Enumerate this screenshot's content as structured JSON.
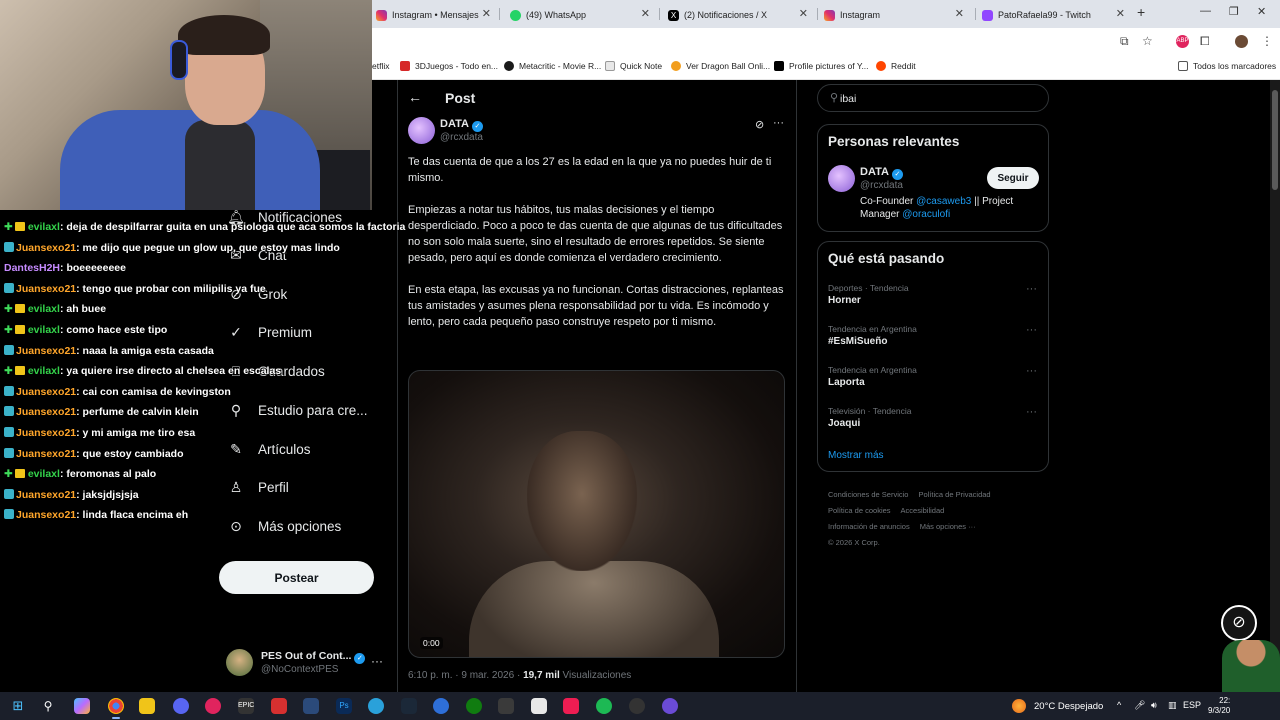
{
  "browser": {
    "tabs": [
      {
        "label": "Instagram • Mensajes",
        "icon": "instagram-icon",
        "color": "#e1306c"
      },
      {
        "label": "(49) WhatsApp",
        "icon": "whatsapp-icon",
        "color": "#25d366"
      },
      {
        "label": "(2) Notificaciones / X",
        "icon": "x-logo-icon",
        "color": "#000000"
      },
      {
        "label": "Instagram",
        "icon": "instagram-icon",
        "color": "#e1306c"
      },
      {
        "label": "PatoRafaela99 - Twitch",
        "icon": "twitch-icon",
        "color": "#9146ff"
      }
    ],
    "bookmarks": [
      {
        "label": "etflix",
        "color": "#e50914"
      },
      {
        "label": "3DJuegos - Todo en...",
        "color": "#d62828"
      },
      {
        "label": "Metacritic - Movie R...",
        "color": "#1a1a1a"
      },
      {
        "label": "Quick Note",
        "color": "#f0f0f0"
      },
      {
        "label": "Ver Dragon Ball Onli...",
        "color": "#f29e1e"
      },
      {
        "label": "Profile pictures of Y...",
        "color": "#000000"
      },
      {
        "label": "Reddit",
        "color": "#ff4500"
      }
    ],
    "all_bookmarks": "Todos los marcadores"
  },
  "chat": {
    "messages": [
      {
        "user": "evilaxl",
        "text": ": deja de despilfarrar guita en una psiologa que aca somos la factoria",
        "user_color": "green",
        "badges": true
      },
      {
        "user": "Juansexo21",
        "text": ": me dijo que pegue un glow up, que estoy mas lindo",
        "user_color": "orange",
        "badges": false
      },
      {
        "user": "DantesH2H",
        "text": ": boeeeeeeee",
        "user_color": "purple",
        "badges": false
      },
      {
        "user": "Juansexo21",
        "text": ": tengo que probar con milipilis ya fue",
        "user_color": "orange",
        "badges": false
      },
      {
        "user": "evilaxl",
        "text": ": ah buee",
        "user_color": "green",
        "badges": true
      },
      {
        "user": "evilaxl",
        "text": ": como hace este tipo",
        "user_color": "green",
        "badges": true
      },
      {
        "user": "Juansexo21",
        "text": ": naaa la amiga esta casada",
        "user_color": "orange",
        "badges": false
      },
      {
        "user": "evilaxl",
        "text": ": ya quiere irse directo al chelsea en escalas",
        "user_color": "green",
        "badges": true
      },
      {
        "user": "Juansexo21",
        "text": ": cai con camisa de kevingston",
        "user_color": "orange",
        "badges": false
      },
      {
        "user": "Juansexo21",
        "text": ": perfume de calvin klein",
        "user_color": "orange",
        "badges": false
      },
      {
        "user": "Juansexo21",
        "text": ": y mi amiga me tiro esa",
        "user_color": "orange",
        "badges": false
      },
      {
        "user": "Juansexo21",
        "text": ": que estoy cambiado",
        "user_color": "orange",
        "badges": false
      },
      {
        "user": "evilaxl",
        "text": ": feromonas al palo",
        "user_color": "green",
        "badges": true
      },
      {
        "user": "Juansexo21",
        "text": ": jaksjdjsjsja",
        "user_color": "orange",
        "badges": false
      },
      {
        "user": "Juansexo21",
        "text": ": linda flaca encima eh",
        "user_color": "orange",
        "badges": false
      }
    ]
  },
  "nav": {
    "items": [
      {
        "label": "Notificaciones",
        "icon": "bell-icon"
      },
      {
        "label": "Chat",
        "icon": "chat-icon"
      },
      {
        "label": "Grok",
        "icon": "grok-icon"
      },
      {
        "label": "Premium",
        "icon": "premium-icon"
      },
      {
        "label": "Guardados",
        "icon": "bookmark-icon"
      },
      {
        "label": "Estudio para cre...",
        "icon": "studio-icon"
      },
      {
        "label": "Artículos",
        "icon": "articles-icon"
      },
      {
        "label": "Perfil",
        "icon": "profile-icon"
      },
      {
        "label": "Más opciones",
        "icon": "more-options-icon"
      }
    ],
    "post_button": "Postear",
    "account": {
      "name": "PES Out of Cont...",
      "handle": "@NoContextPES"
    }
  },
  "post": {
    "header": "Post",
    "author": "DATA",
    "handle": "@rcxdata",
    "paragraphs": [
      "Te das cuenta de que a los 27 es la edad en la que ya no puedes huir de ti mismo.",
      "Empiezas a notar tus hábitos, tus malas decisiones y el tiempo desperdiciado. Poco a poco te das cuenta de que algunas de tus dificultades no son solo mala suerte, sino el resultado de errores repetidos. Se siente pesado, pero aquí es donde comienza el verdadero crecimiento.",
      "En esta etapa, las excusas ya no funcionan. Cortas distracciones, replanteas tus amistades y asumes plena responsabilidad por tu vida. Es incómodo y lento, pero cada pequeño paso construye respeto por ti mismo."
    ],
    "video_time": "0:00",
    "timestamp": "6:10 p. m. · 9 mar. 2026 ·",
    "views_count": "19,7 mil",
    "views_label": "Visualizaciones"
  },
  "sidebar": {
    "search_value": "ibai",
    "relevant_title": "Personas relevantes",
    "relevant": {
      "name": "DATA",
      "handle": "@rcxdata",
      "follow_label": "Seguir",
      "bio_prefix": "Co-Founder ",
      "bio_link1": "@casaweb3",
      "bio_mid": " || Project Manager ",
      "bio_link2": "@oraculofi"
    },
    "trends_title": "Qué está pasando",
    "trends": [
      {
        "category": "Deportes · Tendencia",
        "name": "Horner"
      },
      {
        "category": "Tendencia en Argentina",
        "name": "#EsMiSueño"
      },
      {
        "category": "Tendencia en Argentina",
        "name": "Laporta"
      },
      {
        "category": "Televisión · Tendencia",
        "name": "Joaqui"
      }
    ],
    "show_more": "Mostrar más",
    "footer": [
      "Condiciones de Servicio",
      "Política de Privacidad",
      "Política de cookies",
      "Accesibilidad",
      "Información de anuncios",
      "Más opciones ···",
      "© 2026 X Corp."
    ]
  },
  "taskbar": {
    "weather": "20°C  Despejado",
    "lang": "ESP",
    "time": "22:",
    "date": "9/3/20"
  },
  "colors": {
    "accent": "#1d9bf0",
    "chat_green": "#34d34b",
    "chat_orange": "#ffa62b",
    "chat_purple": "#c68bff"
  }
}
